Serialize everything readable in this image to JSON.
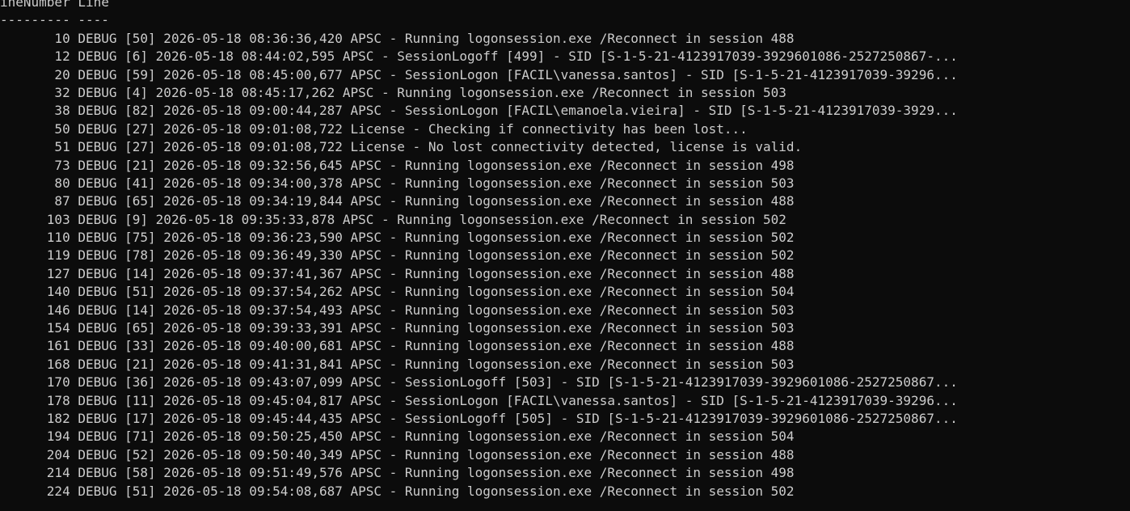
{
  "header": {
    "columns": "ineNumber Line",
    "separator": "--------- ----"
  },
  "rows": [
    {
      "num": "10",
      "text": "DEBUG [50] 2026-05-18 08:36:36,420 APSC - Running logonsession.exe /Reconnect in session 488"
    },
    {
      "num": "12",
      "text": "DEBUG [6] 2026-05-18 08:44:02,595 APSC - SessionLogoff [499] - SID [S-1-5-21-4123917039-3929601086-2527250867-..."
    },
    {
      "num": "20",
      "text": "DEBUG [59] 2026-05-18 08:45:00,677 APSC - SessionLogon [FACIL\\vanessa.santos] - SID [S-1-5-21-4123917039-39296..."
    },
    {
      "num": "32",
      "text": "DEBUG [4] 2026-05-18 08:45:17,262 APSC - Running logonsession.exe /Reconnect in session 503"
    },
    {
      "num": "38",
      "text": "DEBUG [82] 2026-05-18 09:00:44,287 APSC - SessionLogon [FACIL\\emanoela.vieira] - SID [S-1-5-21-4123917039-3929..."
    },
    {
      "num": "50",
      "text": "DEBUG [27] 2026-05-18 09:01:08,722 License - Checking if connectivity has been lost..."
    },
    {
      "num": "51",
      "text": "DEBUG [27] 2026-05-18 09:01:08,722 License - No lost connectivity detected, license is valid."
    },
    {
      "num": "73",
      "text": "DEBUG [21] 2026-05-18 09:32:56,645 APSC - Running logonsession.exe /Reconnect in session 498"
    },
    {
      "num": "80",
      "text": "DEBUG [41] 2026-05-18 09:34:00,378 APSC - Running logonsession.exe /Reconnect in session 503"
    },
    {
      "num": "87",
      "text": "DEBUG [65] 2026-05-18 09:34:19,844 APSC - Running logonsession.exe /Reconnect in session 488"
    },
    {
      "num": "103",
      "text": "DEBUG [9] 2026-05-18 09:35:33,878 APSC - Running logonsession.exe /Reconnect in session 502"
    },
    {
      "num": "110",
      "text": "DEBUG [75] 2026-05-18 09:36:23,590 APSC - Running logonsession.exe /Reconnect in session 502"
    },
    {
      "num": "119",
      "text": "DEBUG [78] 2026-05-18 09:36:49,330 APSC - Running logonsession.exe /Reconnect in session 502"
    },
    {
      "num": "127",
      "text": "DEBUG [14] 2026-05-18 09:37:41,367 APSC - Running logonsession.exe /Reconnect in session 488"
    },
    {
      "num": "140",
      "text": "DEBUG [51] 2026-05-18 09:37:54,262 APSC - Running logonsession.exe /Reconnect in session 504"
    },
    {
      "num": "146",
      "text": "DEBUG [14] 2026-05-18 09:37:54,493 APSC - Running logonsession.exe /Reconnect in session 503"
    },
    {
      "num": "154",
      "text": "DEBUG [65] 2026-05-18 09:39:33,391 APSC - Running logonsession.exe /Reconnect in session 503"
    },
    {
      "num": "161",
      "text": "DEBUG [33] 2026-05-18 09:40:00,681 APSC - Running logonsession.exe /Reconnect in session 488"
    },
    {
      "num": "168",
      "text": "DEBUG [21] 2026-05-18 09:41:31,841 APSC - Running logonsession.exe /Reconnect in session 503"
    },
    {
      "num": "170",
      "text": "DEBUG [36] 2026-05-18 09:43:07,099 APSC - SessionLogoff [503] - SID [S-1-5-21-4123917039-3929601086-2527250867..."
    },
    {
      "num": "178",
      "text": "DEBUG [11] 2026-05-18 09:45:04,817 APSC - SessionLogon [FACIL\\vanessa.santos] - SID [S-1-5-21-4123917039-39296..."
    },
    {
      "num": "182",
      "text": "DEBUG [17] 2026-05-18 09:45:44,435 APSC - SessionLogoff [505] - SID [S-1-5-21-4123917039-3929601086-2527250867..."
    },
    {
      "num": "194",
      "text": "DEBUG [71] 2026-05-18 09:50:25,450 APSC - Running logonsession.exe /Reconnect in session 504"
    },
    {
      "num": "204",
      "text": "DEBUG [52] 2026-05-18 09:50:40,349 APSC - Running logonsession.exe /Reconnect in session 488"
    },
    {
      "num": "214",
      "text": "DEBUG [58] 2026-05-18 09:51:49,576 APSC - Running logonsession.exe /Reconnect in session 498"
    },
    {
      "num": "224",
      "text": "DEBUG [51] 2026-05-18 09:54:08,687 APSC - Running logonsession.exe /Reconnect in session 502"
    }
  ],
  "colors": {
    "background": "#0c0c0c",
    "foreground": "#cccccc"
  }
}
